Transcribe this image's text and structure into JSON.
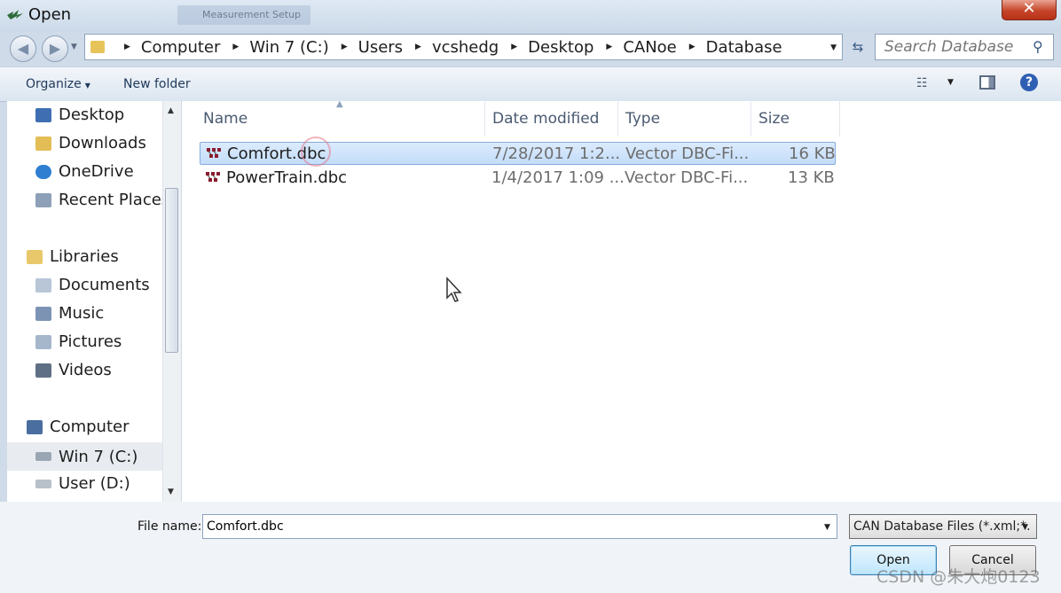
{
  "window": {
    "title": "Open",
    "background_window_title": "Measurement Setup",
    "close_symbol": "✕"
  },
  "navigation": {
    "back_symbol": "◀",
    "forward_symbol": "▶",
    "breadcrumb": [
      "Computer",
      "Win 7 (C:)",
      "Users",
      "vcshedg",
      "Desktop",
      "CANoe",
      "Database"
    ],
    "search_placeholder": "Search Database"
  },
  "toolbar": {
    "organize_label": "Organize",
    "new_folder_label": "New folder"
  },
  "sidebar": {
    "favorites": [
      {
        "label": "Desktop",
        "icon": "desktop-icon"
      },
      {
        "label": "Downloads",
        "icon": "downloads-folder-icon"
      },
      {
        "label": "OneDrive",
        "icon": "onedrive-cloud-icon"
      },
      {
        "label": "Recent Places",
        "icon": "recent-places-icon"
      }
    ],
    "libraries_label": "Libraries",
    "libraries": [
      {
        "label": "Documents",
        "icon": "documents-icon"
      },
      {
        "label": "Music",
        "icon": "music-icon"
      },
      {
        "label": "Pictures",
        "icon": "pictures-icon"
      },
      {
        "label": "Videos",
        "icon": "videos-icon"
      }
    ],
    "computer_label": "Computer",
    "drives": [
      {
        "label": "Win 7 (C:)",
        "icon": "drive-icon",
        "selected": true
      },
      {
        "label": "User (D:)",
        "icon": "drive-icon",
        "selected": false
      }
    ]
  },
  "file_list": {
    "columns": [
      "Name",
      "Date modified",
      "Type",
      "Size"
    ],
    "files": [
      {
        "name": "Comfort.dbc",
        "date": "7/28/2017 1:2...",
        "type": "Vector DBC-Fi...",
        "size": "16 KB",
        "selected": true
      },
      {
        "name": "PowerTrain.dbc",
        "date": "1/4/2017 1:09 ...",
        "type": "Vector DBC-Fi...",
        "size": "13 KB",
        "selected": false
      }
    ]
  },
  "footer": {
    "file_name_label": "File name:",
    "file_name_value": "Comfort.dbc",
    "file_type_filter": "CAN Database Files (*.xml;*.",
    "open_label": "Open",
    "cancel_label": "Cancel"
  },
  "watermark": "CSDN @朱大炮0123",
  "colors": {
    "selection_fill": "#c4ddfa",
    "selection_border": "#84acdd",
    "close_red": "#c5452a",
    "header_text": "#4a5a72"
  }
}
